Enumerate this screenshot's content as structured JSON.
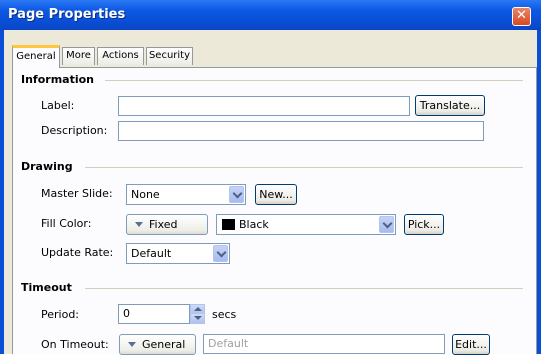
{
  "window": {
    "title": "Page Properties",
    "close_glyph": "✕"
  },
  "tabs": [
    {
      "label": "General"
    },
    {
      "label": "More"
    },
    {
      "label": "Actions"
    },
    {
      "label": "Security"
    }
  ],
  "information": {
    "heading": "Information",
    "label_caption": "Label:",
    "label_value": "",
    "translate_button": "Translate...",
    "description_caption": "Description:",
    "description_value": ""
  },
  "drawing": {
    "heading": "Drawing",
    "master_slide_caption": "Master Slide:",
    "master_slide_value": "None",
    "new_button": "New...",
    "fill_color_caption": "Fill Color:",
    "fill_mode_value": "Fixed",
    "fill_color_value": "Black",
    "fill_color_swatch": "#000000",
    "pick_button": "Pick...",
    "update_rate_caption": "Update Rate:",
    "update_rate_value": "Default"
  },
  "timeout": {
    "heading": "Timeout",
    "period_caption": "Period:",
    "period_value": "0",
    "period_unit": "secs",
    "on_timeout_caption": "On Timeout:",
    "on_timeout_mode": "General",
    "on_timeout_value": "Default",
    "edit_button": "Edit..."
  }
}
